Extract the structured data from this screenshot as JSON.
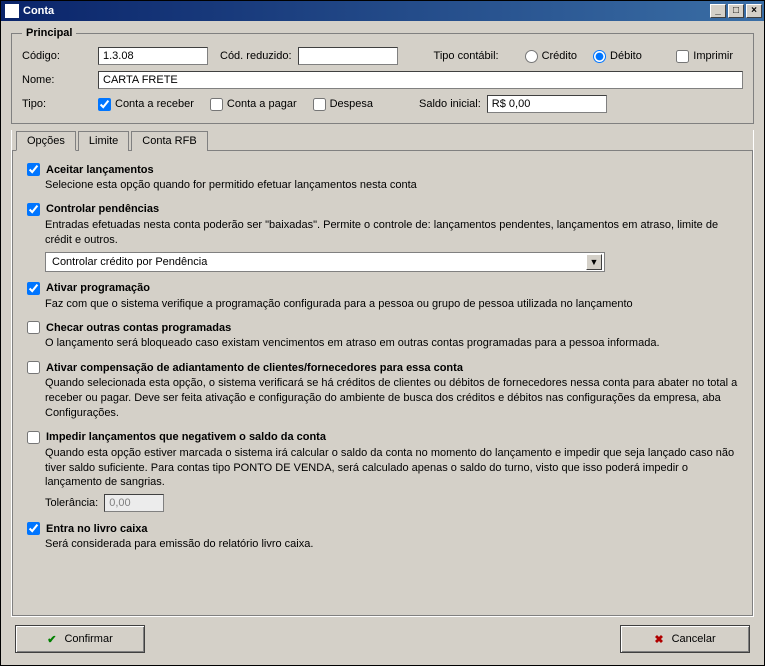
{
  "window": {
    "title": "Conta"
  },
  "group": {
    "legend": "Principal"
  },
  "fields": {
    "codigo_label": "Código:",
    "codigo_value": "1.3.08",
    "cod_reduzido_label": "Cód. reduzido:",
    "cod_reduzido_value": "",
    "tipo_contabil_label": "Tipo contábil:",
    "credito_label": "Crédito",
    "debito_label": "Débito",
    "imprimir_label": "Imprimir",
    "nome_label": "Nome:",
    "nome_value": "CARTA FRETE",
    "tipo_label": "Tipo:",
    "conta_receber_label": "Conta a receber",
    "conta_pagar_label": "Conta a pagar",
    "despesa_label": "Despesa",
    "saldo_inicial_label": "Saldo inicial:",
    "saldo_inicial_value": "R$ 0,00"
  },
  "tabs": {
    "t0": "Opções",
    "t1": "Limite",
    "t2": "Conta RFB"
  },
  "options": {
    "aceitar": {
      "title": "Aceitar lançamentos",
      "desc": "Selecione esta opção quando for permitido efetuar lançamentos nesta conta"
    },
    "controlar": {
      "title": "Controlar pendências",
      "desc": "Entradas efetuadas nesta conta poderão ser \"baixadas\". Permite o controle de: lançamentos pendentes, lançamentos em atraso, limite de crédit e outros.",
      "combo": "Controlar crédito por Pendência"
    },
    "ativar_prog": {
      "title": "Ativar programação",
      "desc": "Faz com que o sistema verifique a programação configurada para a pessoa ou grupo de pessoa utilizada no lançamento"
    },
    "checar": {
      "title": "Checar outras contas programadas",
      "desc": "O lançamento será bloqueado caso existam vencimentos em atraso em outras contas programadas para a pessoa informada."
    },
    "compensacao": {
      "title": "Ativar compensação de adiantamento de clientes/fornecedores para essa conta",
      "desc": "Quando  selecionada esta opção, o sistema verificará se há créditos de clientes ou débitos de fornecedores nessa conta para abater no total a receber ou pagar. Deve ser feita ativação e configuração do ambiente de busca dos créditos e débitos nas configurações da empresa, aba Configurações."
    },
    "impedir": {
      "title": "Impedir lançamentos que negativem o saldo da conta",
      "desc": "Quando esta opção estiver marcada o sistema irá calcular o saldo da conta no momento do lançamento e impedir que seja lançado caso não tiver saldo suficiente. Para contas tipo PONTO DE VENDA, será calculado apenas o saldo do turno, visto que isso poderá impedir o lançamento de sangrias.",
      "tolerancia_label": "Tolerância:",
      "tolerancia_value": "0,00"
    },
    "livro": {
      "title": "Entra no livro caixa",
      "desc": "Será considerada para emissão do relatório livro caixa."
    }
  },
  "buttons": {
    "confirmar": "Confirmar",
    "cancelar": "Cancelar"
  }
}
